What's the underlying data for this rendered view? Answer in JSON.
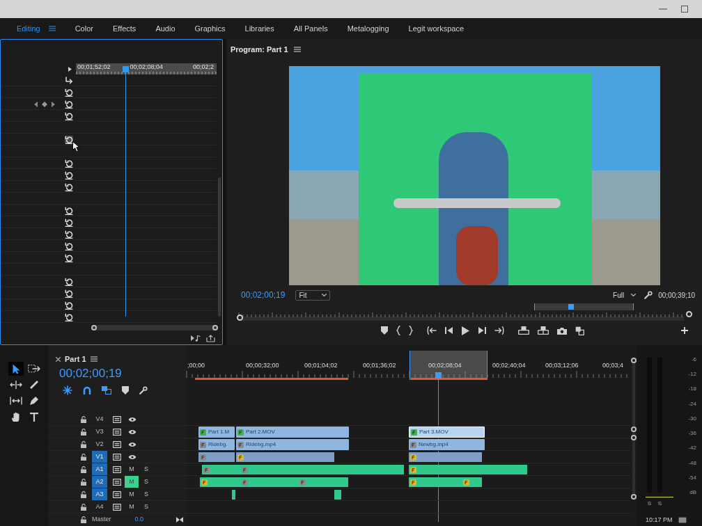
{
  "title_bar": {
    "buttons": [
      {
        "kind": "minimize"
      },
      {
        "kind": "maximize"
      }
    ]
  },
  "workspaces": [
    {
      "label": "Editing",
      "selected": true
    },
    {
      "label": "Color",
      "selected": false
    },
    {
      "label": "Effects",
      "selected": false
    },
    {
      "label": "Audio",
      "selected": false
    },
    {
      "label": "Graphics",
      "selected": false
    },
    {
      "label": "Libraries",
      "selected": false
    },
    {
      "label": "All Panels",
      "selected": false
    },
    {
      "label": "Metalogging",
      "selected": false
    },
    {
      "label": "Legit workspace",
      "selected": false
    }
  ],
  "effect_controls": {
    "focused": true,
    "ruler": [
      "00;01;52;02",
      "00;02;08;04",
      "00;02;2"
    ],
    "rows": [
      {
        "kind": "keyframe-toggle",
        "hovered": false
      },
      {
        "kind": "reset",
        "hovered": false
      },
      {
        "kind": "keyframe-reset",
        "hovered": false
      },
      {
        "kind": "reset",
        "hovered": false
      },
      {
        "kind": "blank"
      },
      {
        "kind": "reset",
        "hovered": true
      },
      {
        "kind": "blank"
      },
      {
        "kind": "reset",
        "hovered": false
      },
      {
        "kind": "reset",
        "hovered": false
      },
      {
        "kind": "reset",
        "hovered": false
      },
      {
        "kind": "blank"
      },
      {
        "kind": "reset",
        "hovered": false
      },
      {
        "kind": "reset",
        "hovered": false
      },
      {
        "kind": "reset",
        "hovered": false
      },
      {
        "kind": "reset",
        "hovered": false
      },
      {
        "kind": "reset",
        "hovered": false
      },
      {
        "kind": "blank"
      },
      {
        "kind": "reset",
        "hovered": false
      },
      {
        "kind": "reset",
        "hovered": false
      },
      {
        "kind": "reset",
        "hovered": false
      },
      {
        "kind": "reset",
        "hovered": false
      }
    ],
    "footer": [
      {
        "kind": "play-audio"
      },
      {
        "kind": "export"
      }
    ]
  },
  "program_monitor": {
    "title": "Program: Part 1",
    "timecode": "00;02;00;19",
    "zoom": "Fit",
    "resolution": "Full",
    "duration": "00;00;39;10",
    "controls": [
      {
        "kind": "marker"
      },
      {
        "kind": "mark-in"
      },
      {
        "kind": "mark-out"
      },
      {
        "kind": "go-to-in"
      },
      {
        "kind": "step-back"
      },
      {
        "kind": "play"
      },
      {
        "kind": "step-forward"
      },
      {
        "kind": "go-to-out"
      },
      {
        "kind": "lift"
      },
      {
        "kind": "extract"
      },
      {
        "kind": "export-frame"
      },
      {
        "kind": "compare"
      }
    ]
  },
  "tools": [
    {
      "kind": "selection",
      "selected": true
    },
    {
      "kind": "track-select",
      "selected": false
    },
    {
      "kind": "ripple",
      "selected": false
    },
    {
      "kind": "razor",
      "selected": false
    },
    {
      "kind": "slip",
      "selected": false
    },
    {
      "kind": "pen",
      "selected": false
    },
    {
      "kind": "hand",
      "selected": false
    },
    {
      "kind": "type",
      "selected": false
    }
  ],
  "timeline": {
    "tab": {
      "label": "Part 1",
      "closable": true
    },
    "timecode": "00;02;00;19",
    "options": [
      {
        "kind": "nest",
        "on": true
      },
      {
        "kind": "snap",
        "on": true
      },
      {
        "kind": "linked",
        "on": true
      },
      {
        "kind": "marker",
        "on": false
      },
      {
        "kind": "settings",
        "on": false
      }
    ],
    "ruler": [
      ";00;00",
      "00;00;32;00",
      "00;01;04;02",
      "00;01;36;02",
      "00;02;08;04",
      "00;02;40;04",
      "00;03;12;06",
      "00;03;4"
    ],
    "tracks": [
      {
        "name": "V4",
        "kind": "video",
        "selected": false
      },
      {
        "name": "V3",
        "kind": "video",
        "selected": false,
        "clips": [
          {
            "name": "Part 1.M",
            "selected": false,
            "badge": {
              "color": "#45b04f"
            }
          },
          {
            "name": "Part 2.MOV",
            "selected": false,
            "badge": {
              "color": "#45b04f"
            }
          },
          {
            "name": "Part 3.MOV",
            "selected": true,
            "badge": {
              "color": "#45b04f"
            }
          }
        ]
      },
      {
        "name": "V2",
        "kind": "video",
        "selected": false,
        "clips": [
          {
            "name": "Ridebg.",
            "selected": false,
            "badge": {
              "color": "#8c8c8c"
            }
          },
          {
            "name": "Ridebg.mp4",
            "selected": false,
            "badge": {
              "color": "#8c8c8c"
            }
          },
          {
            "name": "Newbg.mp4",
            "selected": false,
            "badge": {
              "color": "#8c8c8c"
            }
          }
        ]
      },
      {
        "name": "V1",
        "kind": "video",
        "selected": true,
        "clips": [
          {
            "selected": false,
            "badge": {
              "color": "#8c8c8c"
            }
          },
          {
            "selected": false,
            "badge": {
              "color": "#e3b524"
            }
          },
          {
            "selected": false,
            "badge": {
              "color": "#e3b524"
            }
          }
        ]
      },
      {
        "name": "A1",
        "kind": "audio",
        "selected": true,
        "muted": false,
        "mute_label": "M",
        "solo_label": "S",
        "clips": [
          {
            "selected": false,
            "badge": {
              "color": "#8c8c8c"
            }
          },
          {
            "selected": false,
            "badge": {
              "color": "#8c8c8c"
            }
          },
          {
            "selected": false,
            "badge": {
              "color": "#e3b524"
            }
          }
        ]
      },
      {
        "name": "A2",
        "kind": "audio",
        "selected": true,
        "muted": true,
        "mute_label": "M",
        "solo_label": "S",
        "clips": [
          {
            "selected": false,
            "badge": {
              "color": "#e3b524"
            }
          },
          {
            "selected": false,
            "badge": {
              "color": "#8c8c8c"
            }
          },
          {
            "selected": false,
            "badge": {
              "color": "#8c8c8c"
            }
          },
          {
            "selected": false,
            "badge": {
              "color": "#e3b524"
            }
          },
          {
            "selected": false,
            "badge": {
              "color": "#e3b524"
            }
          }
        ]
      },
      {
        "name": "A3",
        "kind": "audio",
        "selected": true,
        "muted": false,
        "mute_label": "M",
        "solo_label": "S",
        "clips": [
          {
            "selected": false
          },
          {
            "selected": false
          }
        ]
      },
      {
        "name": "A4",
        "kind": "audio",
        "selected": false,
        "muted": false,
        "mute_label": "M",
        "solo_label": "S"
      }
    ],
    "master": {
      "name": "Master",
      "value": "0.0"
    }
  },
  "audio_meter": {
    "scale": [
      "-6",
      "-12",
      "-18",
      "-24",
      "-30",
      "-36",
      "-42",
      "-48",
      "-54",
      "dB"
    ],
    "solo": [
      "S",
      "S"
    ]
  },
  "taskbar": {
    "time": "10:17 PM"
  }
}
